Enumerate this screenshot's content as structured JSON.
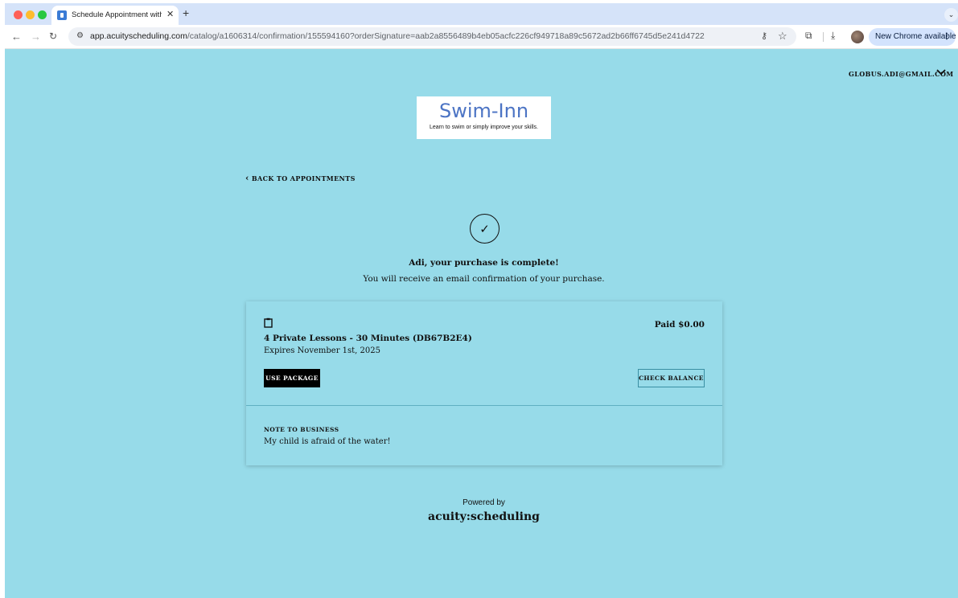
{
  "browser": {
    "tab_title": "Schedule Appointment with S",
    "tab_close": "✕",
    "new_tab": "+",
    "url_host": "app.acuityscheduling.com",
    "url_path": "/catalog/a1606314/confirmation/155594160?orderSignature=aab2a8556489b4eb05acfc226cf949718a89c5672ad2b66ff6745d5e241d4722",
    "update_label": "New Chrome available",
    "icons": [
      "back-arrow-icon",
      "forward-arrow-icon",
      "reload-icon",
      "site-info-icon",
      "key-icon",
      "star-icon",
      "extensions-icon",
      "download-icon",
      "profile-avatar",
      "kebab-menu-icon"
    ]
  },
  "header": {
    "account_email": "GLOBUS.ADI@GMAIL.COM"
  },
  "logo": {
    "name": "Swim-Inn",
    "tagline": "Learn to swim or simply improve your skills.",
    "name_color": "#4c74c4"
  },
  "nav": {
    "back_label": "BACK TO APPOINTMENTS"
  },
  "confirmation": {
    "title": "Adi, your purchase is complete!",
    "subtitle": "You will receive an email confirmation of your purchase."
  },
  "order": {
    "package_name": "4 Private Lessons - 30 Minutes (DB67B2E4)",
    "expiry": "Expires November 1st, 2025",
    "paid": "Paid $0.00",
    "use_button": "USE PACKAGE",
    "balance_button": "CHECK BALANCE",
    "note_label": "NOTE TO BUSINESS",
    "note_text": "My child is afraid of the water!"
  },
  "footer": {
    "powered_by": "Powered by",
    "brand": "acuity:scheduling"
  },
  "colors": {
    "page_background": "#97dbe9",
    "primary_button": "#000000"
  }
}
